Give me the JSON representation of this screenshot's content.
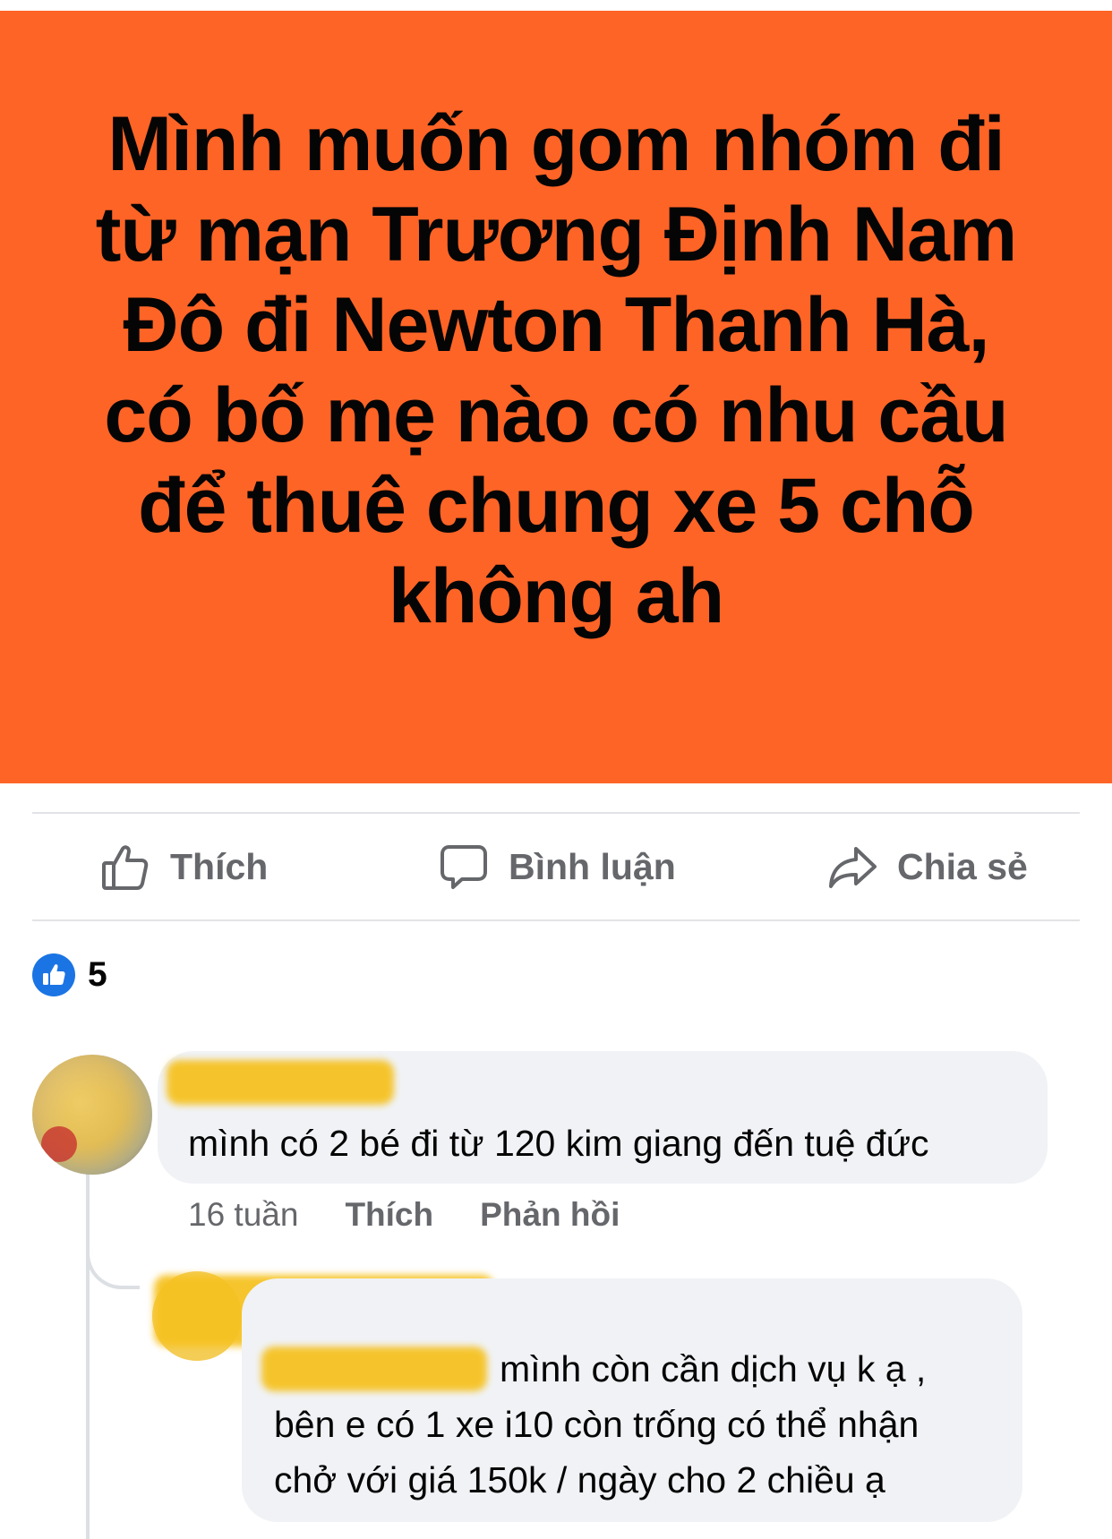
{
  "post": {
    "text": "Mình muốn gom nhóm đi\ntừ mạn Trương Định Nam\nĐô đi Newton Thanh Hà,\ncó bố mẹ nào có nhu cầu\nđể thuê chung xe 5 chỗ\nkhông ah",
    "background_color": "#fe6426"
  },
  "actions": {
    "like_label": "Thích",
    "comment_label": "Bình luận",
    "share_label": "Chia sẻ"
  },
  "reactions": {
    "count": "5",
    "icon": "thumbs-up-icon"
  },
  "comments": [
    {
      "text": "mình có 2 bé đi từ 120 kim giang đến tuệ đức",
      "time": "16 tuần",
      "like_label": "Thích",
      "reply_label": "Phản hồi",
      "replies": [
        {
          "line1": "mình còn cần dịch vụ k ạ ,",
          "line2": "bên e có 1 xe i10 còn trống có thể nhận",
          "line3": "chở với giá 150k / ngày cho 2 chiều ạ"
        }
      ]
    }
  ]
}
